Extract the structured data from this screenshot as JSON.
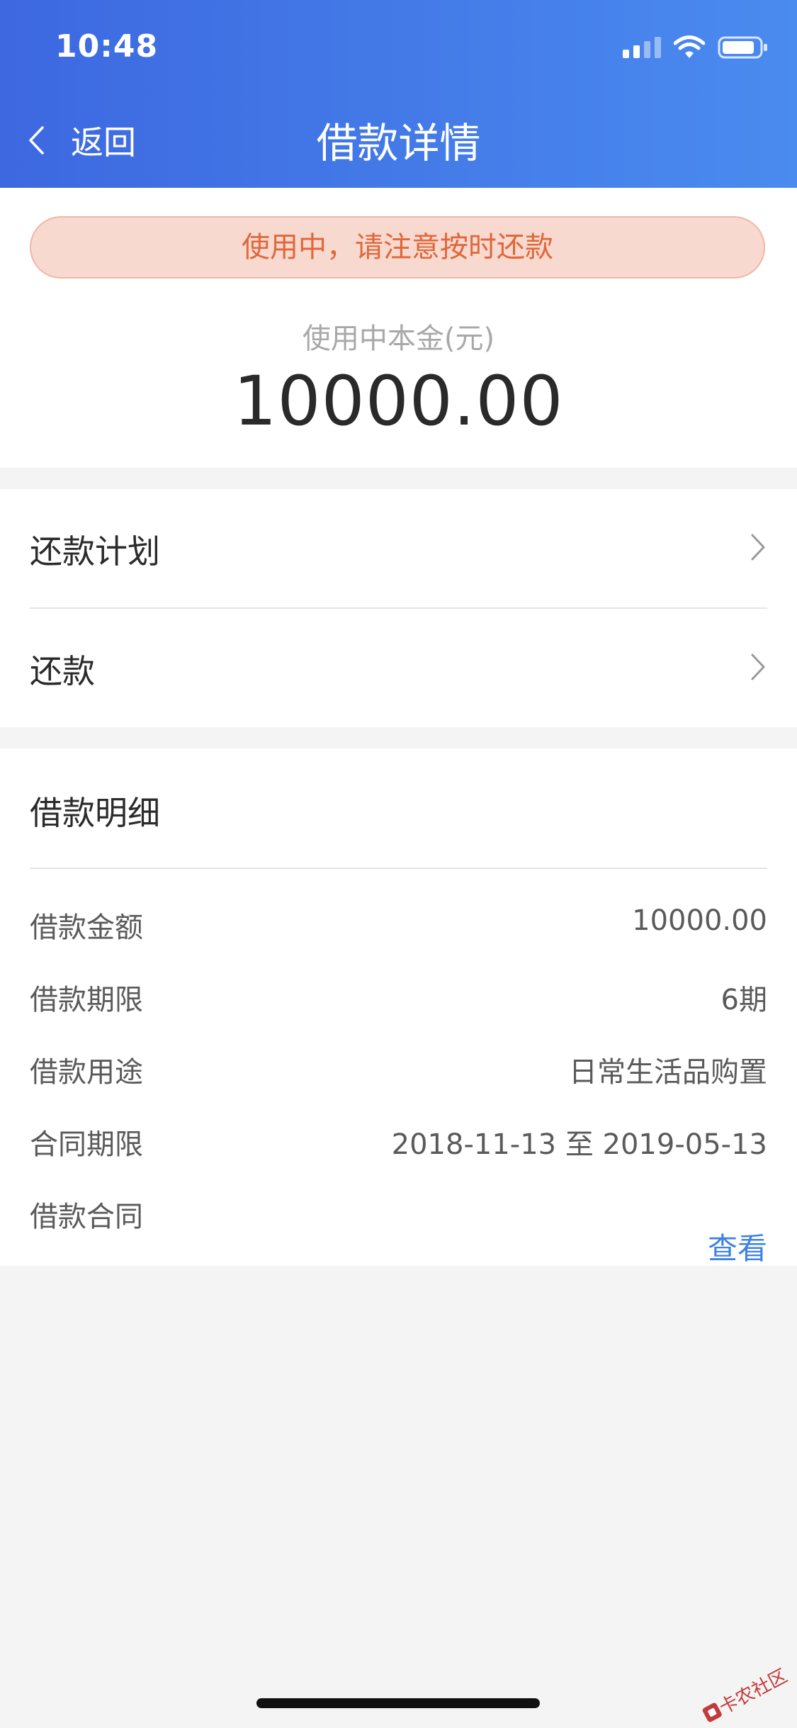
{
  "status_bar": {
    "time": "10:48"
  },
  "nav": {
    "back_label": "返回",
    "title": "借款详情"
  },
  "loan_status": {
    "banner_text": "使用中，请注意按时还款",
    "principal_label": "使用中本金(元)",
    "principal_amount": "10000.00"
  },
  "actions": [
    {
      "label": "还款计划"
    },
    {
      "label": "还款"
    }
  ],
  "details": {
    "title": "借款明细",
    "rows": [
      {
        "label": "借款金额",
        "value": "10000.00"
      },
      {
        "label": "借款期限",
        "value": "6期"
      },
      {
        "label": "借款用途",
        "value": "日常生活品购置"
      },
      {
        "label": "合同期限",
        "value": "2018-11-13 至 2019-05-13"
      },
      {
        "label": "借款合同",
        "link": "查看"
      }
    ]
  },
  "watermark": {
    "text": "卡农社区"
  },
  "colors": {
    "header_start": "#3d68e0",
    "header_end": "#4a8bef",
    "banner_bg": "#f7d9cf",
    "banner_text": "#e0673a",
    "link": "#3f82e0"
  }
}
